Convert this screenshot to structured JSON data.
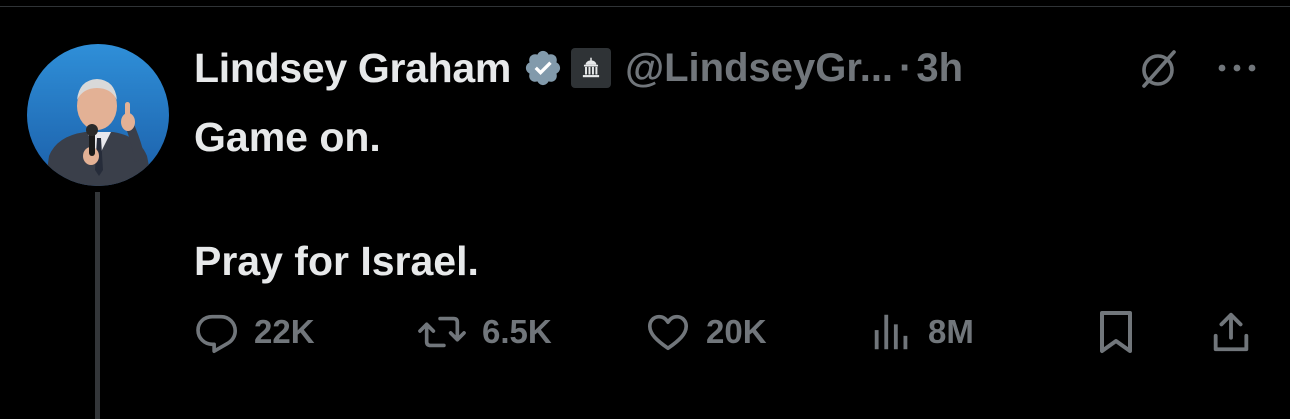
{
  "author": {
    "display_name": "Lindsey Graham",
    "handle": "@LindseyGr...",
    "separator": "·",
    "time": "3h"
  },
  "tweet": {
    "lines": [
      "Game on.",
      "Pray for Israel."
    ]
  },
  "actions": {
    "replies": "22K",
    "reposts": "6.5K",
    "likes": "20K",
    "views": "8M"
  },
  "icons": {
    "verified": "verified-badge-icon",
    "government": "government-building-icon",
    "grok": "grok-icon",
    "more": "more-dots-icon",
    "reply": "reply-icon",
    "repost": "repost-icon",
    "like": "heart-icon",
    "views": "views-chart-icon",
    "bookmark": "bookmark-icon",
    "share": "share-icon"
  },
  "colors": {
    "background": "#000000",
    "text_primary": "#e7e9ea",
    "text_secondary": "#71767b",
    "verified_badge": "#829aab",
    "thread_line": "#333639"
  }
}
